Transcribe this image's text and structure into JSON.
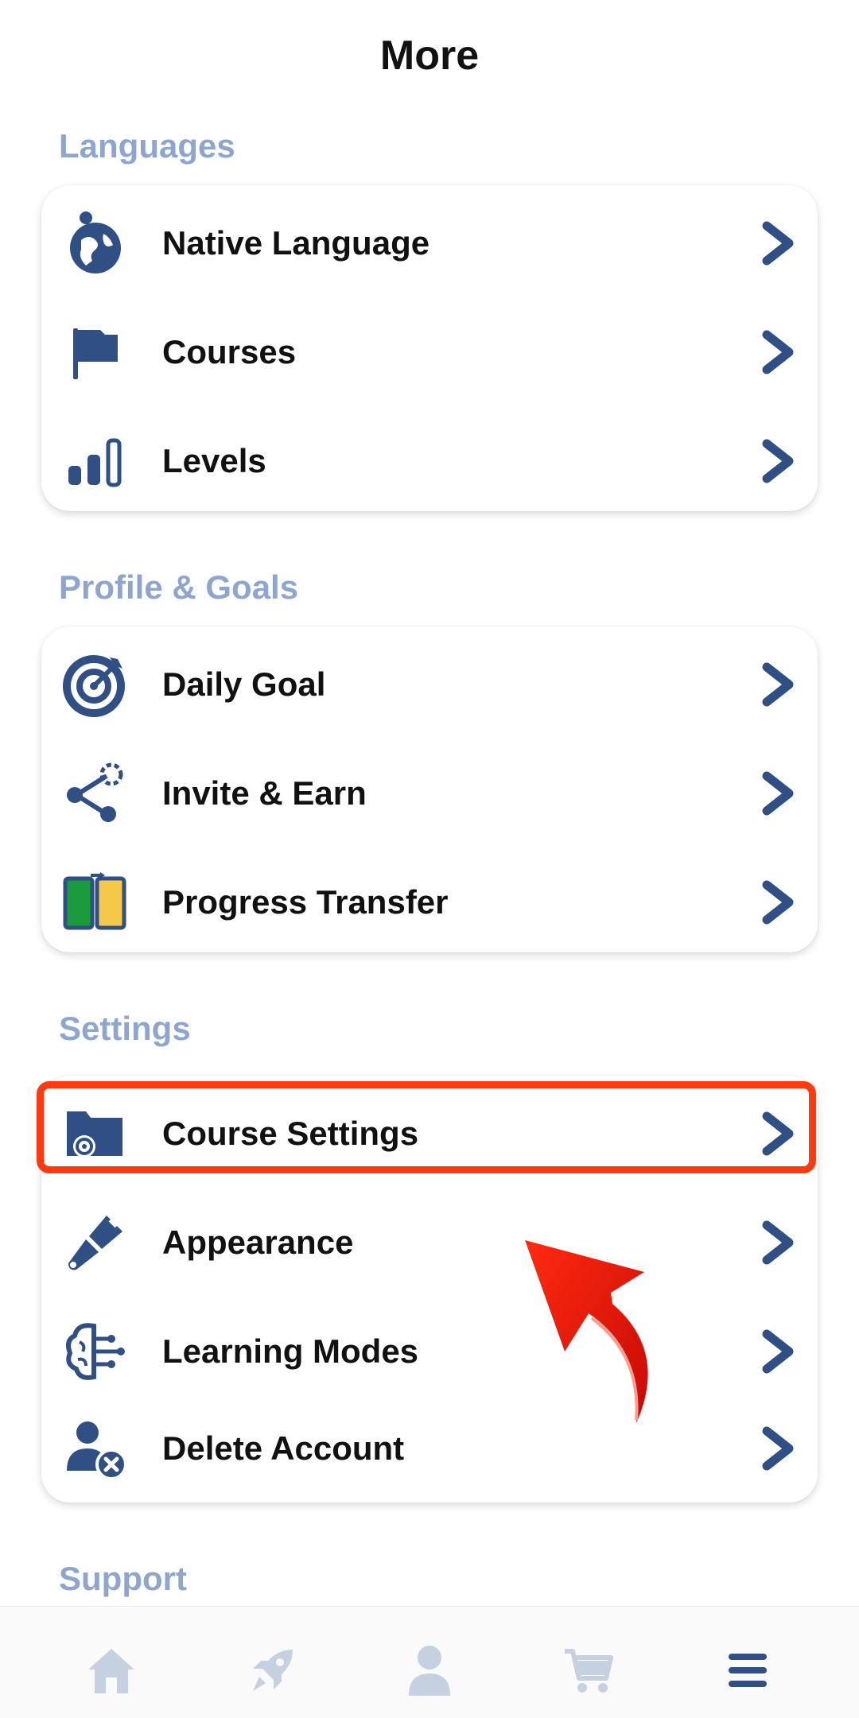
{
  "header": {
    "title": "More"
  },
  "sections": [
    {
      "label": "Languages",
      "items": [
        {
          "label": "Native Language",
          "icon": "globe-person-icon"
        },
        {
          "label": "Courses",
          "icon": "flag-icon"
        },
        {
          "label": "Levels",
          "icon": "bars-icon"
        }
      ]
    },
    {
      "label": "Profile & Goals",
      "items": [
        {
          "label": "Daily Goal",
          "icon": "target-icon"
        },
        {
          "label": "Invite & Earn",
          "icon": "share-icon"
        },
        {
          "label": "Progress Transfer",
          "icon": "transfer-icon"
        }
      ]
    },
    {
      "label": "Settings",
      "items": [
        {
          "label": "Course Settings",
          "icon": "folder-gear-icon"
        },
        {
          "label": "Appearance",
          "icon": "brush-icon"
        },
        {
          "label": "Learning Modes",
          "icon": "brain-circuit-icon"
        },
        {
          "label": "Delete Account",
          "icon": "user-remove-icon"
        }
      ]
    },
    {
      "label": "Support",
      "items": []
    }
  ],
  "bottom_nav": [
    {
      "name": "home",
      "icon": "home-icon"
    },
    {
      "name": "rocket",
      "icon": "rocket-icon"
    },
    {
      "name": "profile",
      "icon": "person-icon"
    },
    {
      "name": "shop",
      "icon": "cart-icon"
    },
    {
      "name": "more",
      "icon": "menu-icon",
      "active": true
    }
  ],
  "colors": {
    "primary": "#2f4f85",
    "section_label": "#8ea6cf",
    "highlight": "#ff3a10",
    "nav_inactive": "#c5d0e0",
    "arrow": "#e0190c"
  }
}
